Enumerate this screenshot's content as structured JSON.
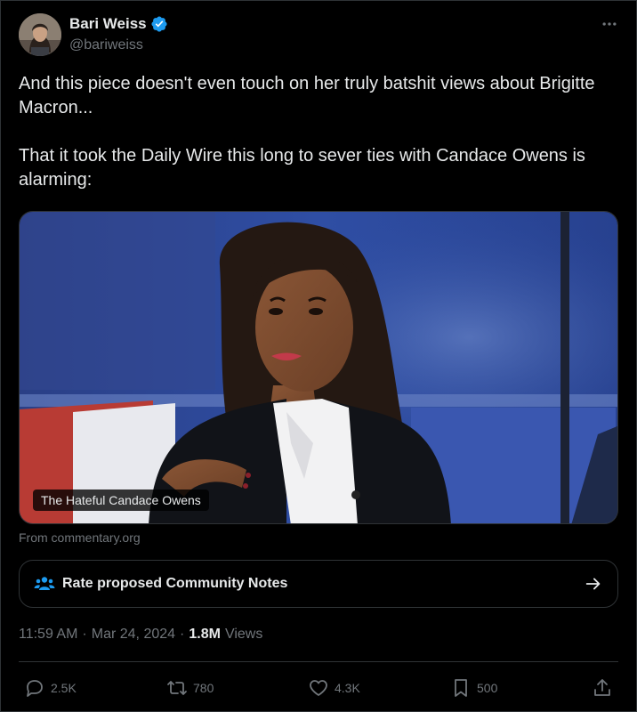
{
  "author": {
    "display_name": "Bari Weiss",
    "handle": "@bariweiss",
    "verified": true,
    "verified_color": "#1d9bf0"
  },
  "tweet": {
    "paragraph_1": "And this piece doesn't even touch on her truly batshit views about Brigitte Macron...",
    "paragraph_2": "That it took the Daily Wire this long to sever ties with Candace Owens is alarming:"
  },
  "link_card": {
    "caption": "The Hateful Candace Owens",
    "source": "From commentary.org"
  },
  "community_notes": {
    "label": "Rate proposed Community Notes",
    "icon": "people-icon",
    "accent": "#1d9bf0"
  },
  "meta": {
    "time": "11:59 AM",
    "date": "Mar 24, 2024",
    "separator": "·",
    "views_count": "1.8M",
    "views_label": "Views"
  },
  "actions": {
    "replies": "2.5K",
    "reposts": "780",
    "likes": "4.3K",
    "bookmarks": "500"
  }
}
